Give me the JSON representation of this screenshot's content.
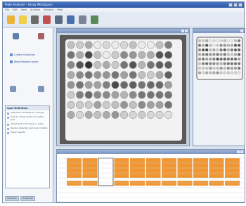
{
  "window": {
    "title": "Plate Analyzer - Assay Workspace"
  },
  "menu": [
    "File",
    "Edit",
    "View",
    "Analysis",
    "Window",
    "Help"
  ],
  "toolbar": {
    "buttons": [
      {
        "icon": "folder-icon",
        "color": "#e8b43c"
      },
      {
        "icon": "sun-icon",
        "color": "#f0d040"
      },
      {
        "icon": "camera-icon",
        "color": "#6b6b6b"
      },
      {
        "icon": "chart-icon",
        "color": "#c05050"
      },
      {
        "icon": "calculator-icon",
        "color": "#5a6a80"
      },
      {
        "icon": "grid-icon",
        "color": "#4a70b0"
      },
      {
        "icon": "plate-icon",
        "color": "#7a8696"
      },
      {
        "icon": "export-icon",
        "color": "#5a8a5a"
      }
    ]
  },
  "left_panel": {
    "links": [
      "Create Collection",
      "Move/Rotate Layers"
    ],
    "task_box": {
      "title": "Spot Definition",
      "items": [
        "Select the template for analysis",
        "Click to detect spots and define grid",
        "Adjust grid to fit spots on plate",
        "Review detected spot data in table",
        "Export results"
      ]
    },
    "tabs": [
      "Workflow",
      "Properties"
    ]
  },
  "plate": {
    "rows": 8,
    "cols": 12,
    "shades": [
      [
        0.2,
        0.15,
        0.3,
        0.0,
        0.1,
        0.0,
        0.1,
        0.2,
        0.0,
        0.0,
        0.2,
        0.5
      ],
      [
        0.55,
        0.3,
        0.75,
        0.2,
        0.0,
        0.15,
        0.45,
        0.4,
        0.25,
        0.3,
        0.7,
        0.7
      ],
      [
        0.45,
        0.7,
        0.85,
        0.2,
        0.3,
        0.15,
        0.55,
        0.7,
        0.25,
        0.55,
        0.65,
        0.65
      ],
      [
        0.3,
        0.45,
        0.55,
        0.4,
        0.4,
        0.55,
        0.35,
        0.55,
        0.2,
        0.15,
        0.3,
        0.65
      ],
      [
        0.4,
        0.55,
        0.35,
        0.35,
        0.5,
        0.75,
        0.6,
        0.65,
        0.55,
        0.6,
        0.6,
        0.35
      ],
      [
        0.15,
        0.5,
        0.6,
        0.45,
        0.45,
        0.35,
        0.25,
        0.45,
        0.55,
        0.55,
        0.55,
        0.55
      ],
      [
        0.15,
        0.15,
        0.15,
        0.35,
        0.15,
        0.2,
        0.4,
        0.2,
        0.45,
        0.35,
        0.35,
        0.55
      ],
      [
        0.3,
        0.1,
        0.3,
        0.2,
        0.3,
        0.4,
        0.15,
        0.1,
        0.15,
        0.1,
        0.1,
        0.05
      ]
    ]
  },
  "table": {
    "bar_color": "#f09632",
    "bars": [
      1,
      1,
      0,
      1,
      1,
      1,
      1,
      1,
      1,
      1,
      1
    ]
  }
}
